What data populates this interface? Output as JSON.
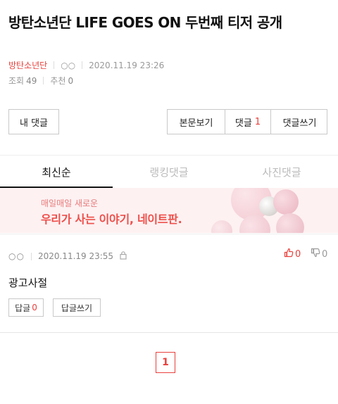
{
  "post": {
    "title": "방탄소년단 LIFE GOES ON 두번째 티저 공개",
    "board": "방탄소년단",
    "author": "○○",
    "datetime": "2020.11.19 23:26",
    "views_label": "조회",
    "views": "49",
    "recommend_label": "추천",
    "recommend": "0"
  },
  "actions": {
    "my_comments": "내 댓글",
    "view_post": "본문보기",
    "comments_label": "댓글",
    "comments_count": "1",
    "write_comment": "댓글쓰기"
  },
  "tabs": [
    {
      "label": "최신순",
      "active": true
    },
    {
      "label": "랭킹댓글",
      "active": false
    },
    {
      "label": "사진댓글",
      "active": false
    }
  ],
  "banner": {
    "line1": "매일매일 새로운",
    "line2": "우리가 사는 이야기, 네이트판."
  },
  "comment": {
    "author": "○○",
    "datetime": "2020.11.19 23:55",
    "upvotes": "0",
    "downvotes": "0",
    "text": "광고사절",
    "reply_label": "답글",
    "reply_count": "0",
    "write_reply_label": "답글쓰기"
  },
  "pagination": {
    "current_page": "1"
  },
  "colors": {
    "accent": "#e8413d",
    "banner_bg": "#fdf1f2"
  }
}
